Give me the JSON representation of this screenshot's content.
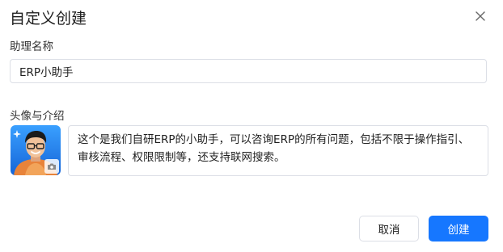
{
  "dialog": {
    "title": "自定义创建",
    "close_icon": "close-icon"
  },
  "form": {
    "name_label": "助理名称",
    "name_value": "ERP小助手",
    "avatar_label": "头像与介绍",
    "avatar_icon": "camera-icon",
    "description": "这个是我们自研ERP的小助手，可以咨询ERP的所有问题，包括不限于操作指引、审核流程、权限限制等，还支持联网搜索。"
  },
  "footer": {
    "cancel_label": "取消",
    "create_label": "创建"
  },
  "colors": {
    "primary": "#1677ff",
    "border": "#dcdfe6"
  }
}
